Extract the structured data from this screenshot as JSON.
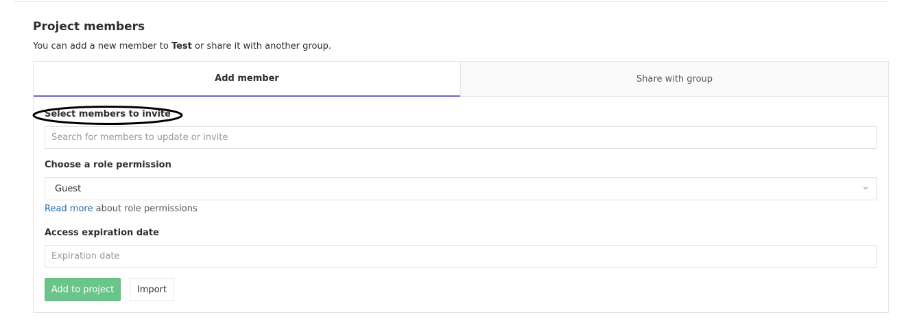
{
  "section": {
    "title": "Project members",
    "intro_prefix": "You can add a new member to ",
    "project_name": "Test",
    "intro_suffix": " or share it with another group."
  },
  "tabs": [
    {
      "label": "Add member",
      "active": true
    },
    {
      "label": "Share with group",
      "active": false
    }
  ],
  "form": {
    "members_label": "Select members to invite",
    "members_placeholder": "Search for members to update or invite",
    "role_label": "Choose a role permission",
    "role_selected": "Guest",
    "help_link": "Read more",
    "help_suffix": " about role permissions",
    "expiration_label": "Access expiration date",
    "expiration_placeholder": "Expiration date"
  },
  "actions": {
    "add_label": "Add to project",
    "import_label": "Import"
  },
  "colors": {
    "active_tab_underline": "#6666c4",
    "primary_button": "#6bc48b",
    "link": "#1b69b6"
  },
  "icons": {
    "select_chevron": "chevron-down-icon"
  }
}
